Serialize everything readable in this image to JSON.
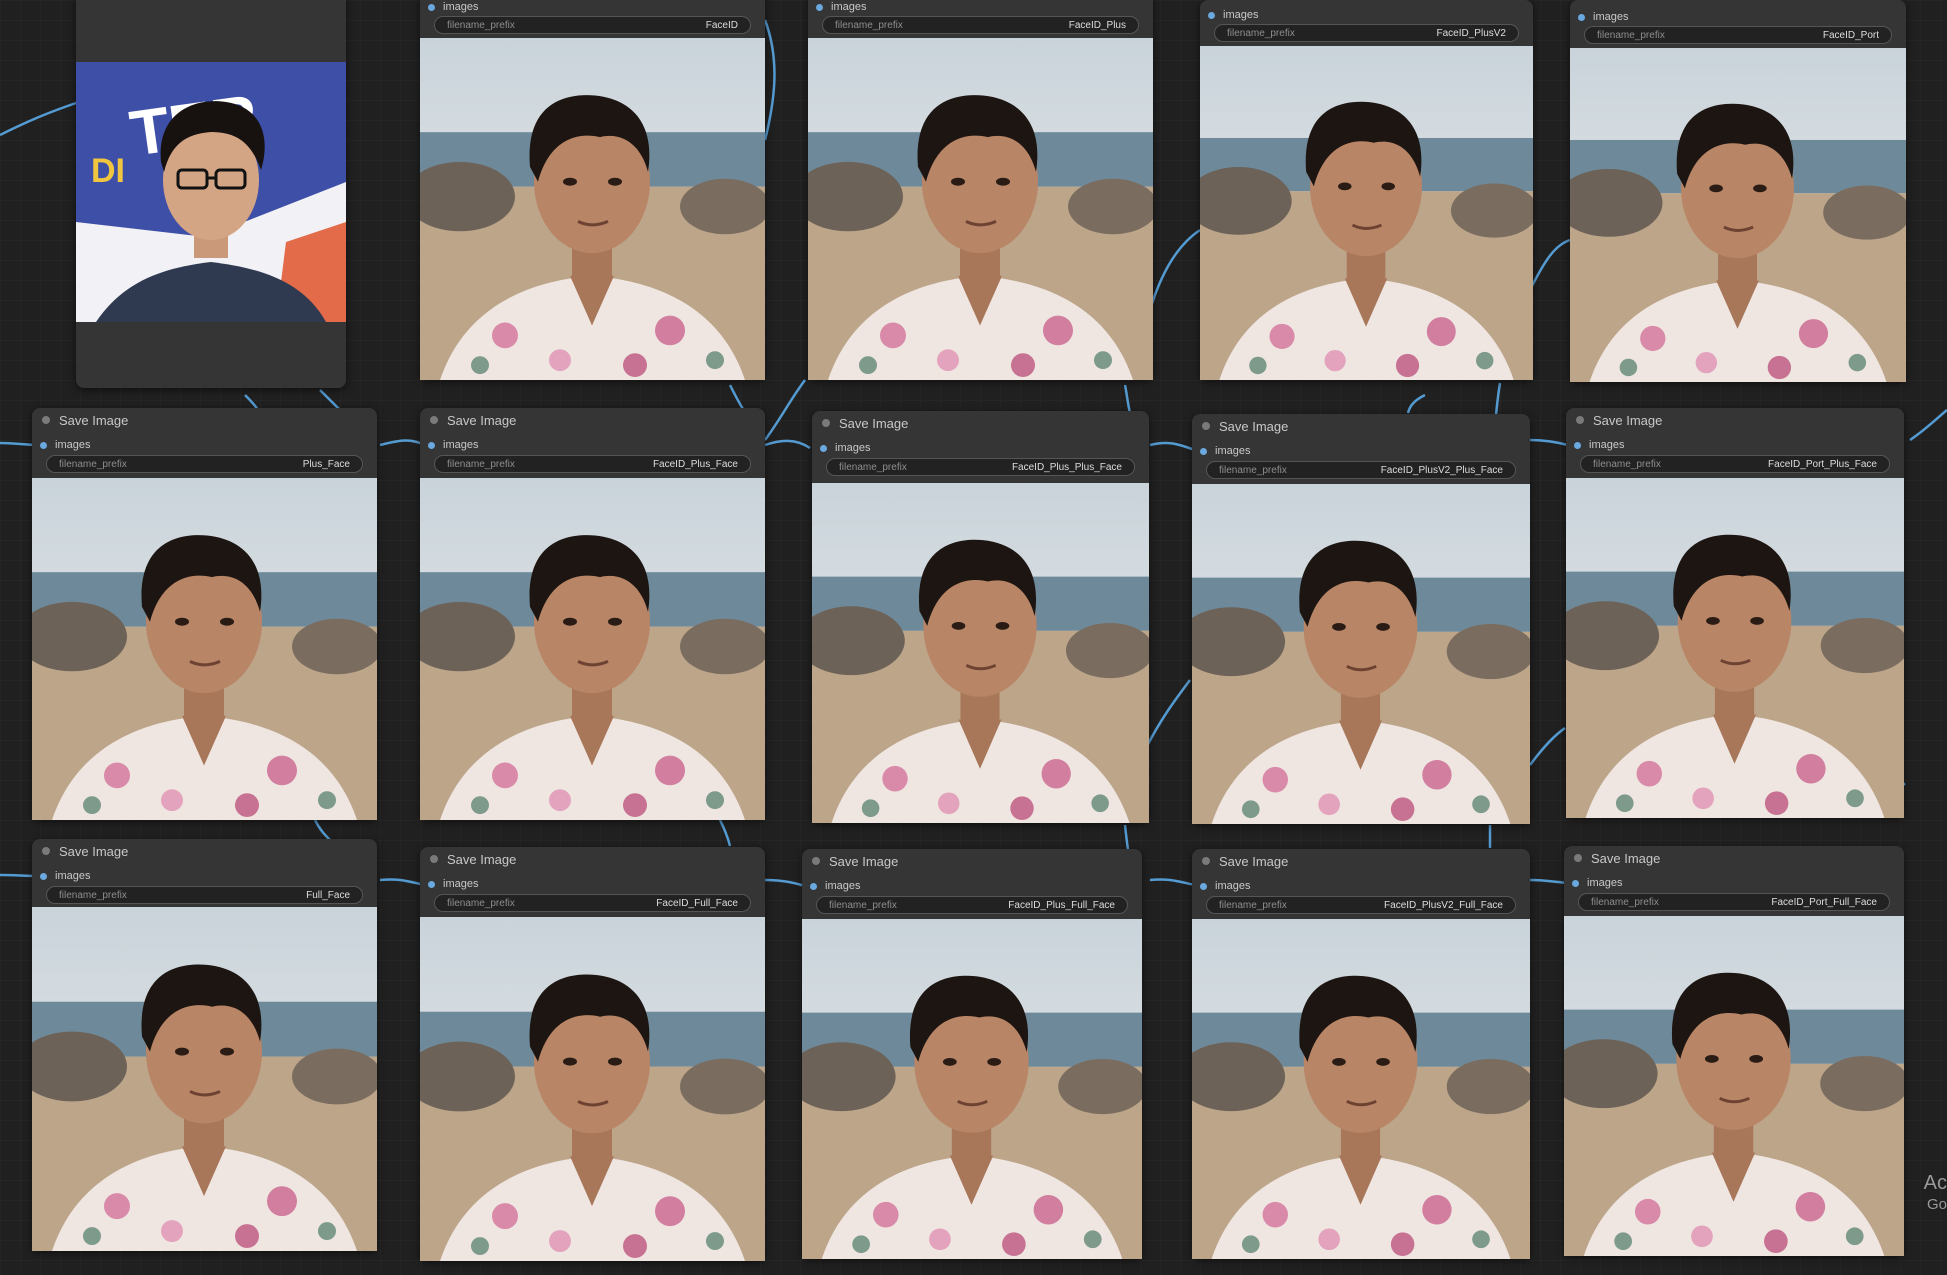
{
  "node": {
    "title": "Save Image",
    "input_label": "images",
    "widget_name": "filename_prefix"
  },
  "prefixes": {
    "r0c1": "FaceID",
    "r0c2": "FaceID_Plus",
    "r0c3": "FaceID_PlusV2",
    "r0c4": "FaceID_Port",
    "r1c0": "Plus_Face",
    "r1c1": "FaceID_Plus_Face",
    "r1c2": "FaceID_Plus_Plus_Face",
    "r1c3": "FaceID_PlusV2_Plus_Face",
    "r1c4": "FaceID_Port_Plus_Face",
    "r2c0": "Full_Face",
    "r2c1": "FaceID_Full_Face",
    "r2c2": "FaceID_Plus_Full_Face",
    "r2c3": "FaceID_PlusV2_Full_Face",
    "r2c4": "FaceID_Port_Full_Face"
  },
  "watermark": {
    "line1": "Ac",
    "line2": "Go"
  },
  "colors": {
    "canvas": "#202020",
    "node_body": "#353535",
    "wire": "#5aa9e6",
    "widget_bg": "#222222"
  },
  "photos": {
    "reference": "reference-selfie-with-glasses",
    "generated": "beach-portrait-floral-shirt"
  }
}
